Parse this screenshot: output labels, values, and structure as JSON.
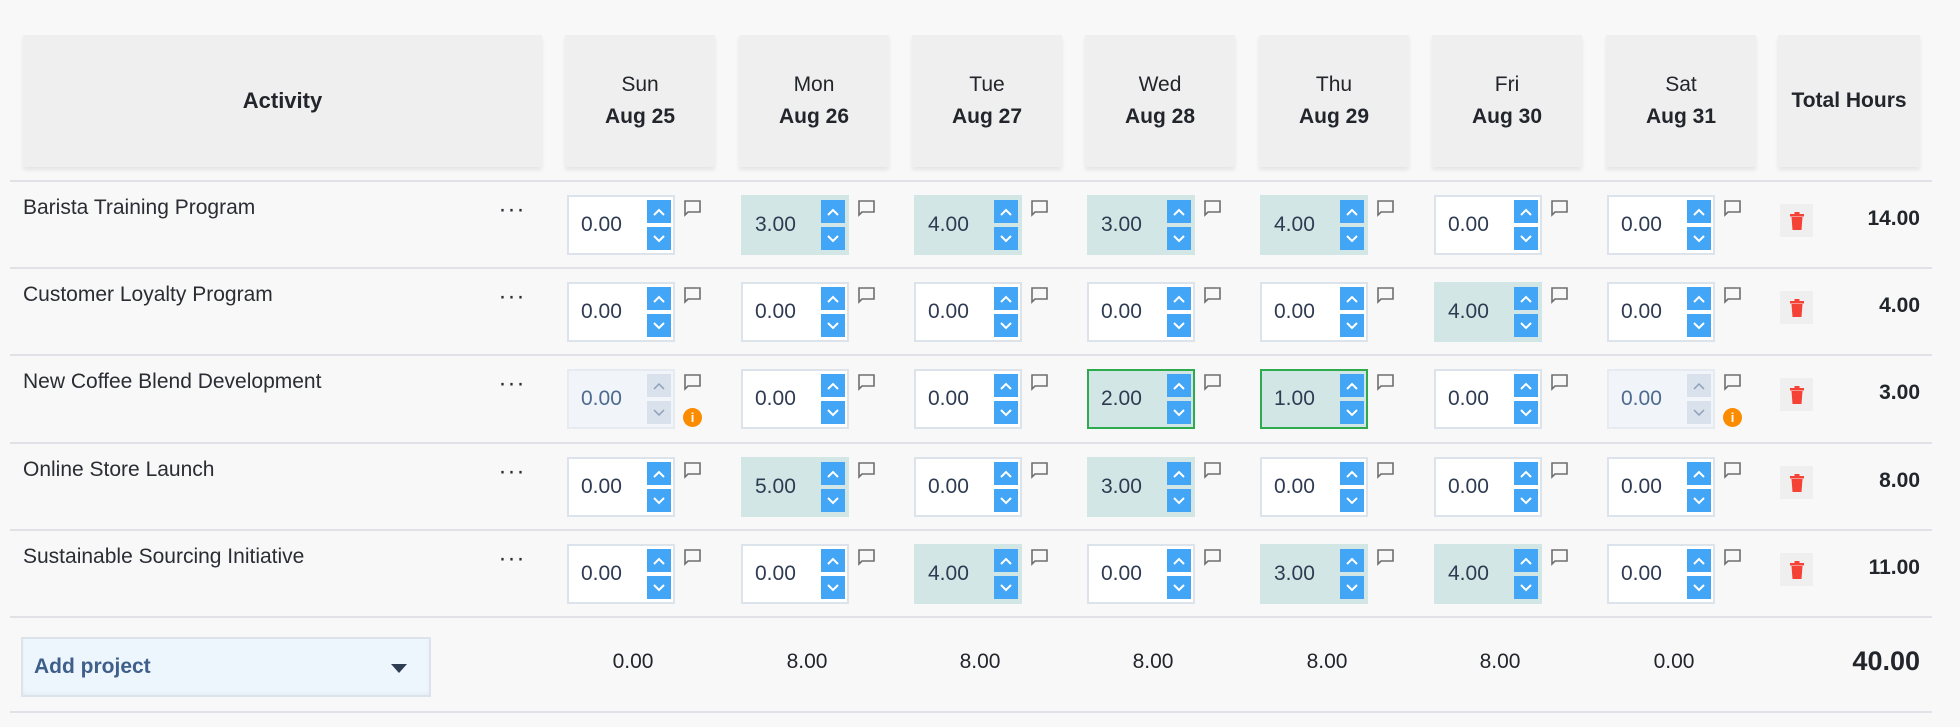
{
  "header": {
    "activity_label": "Activity",
    "total_label": "Total Hours",
    "days": [
      {
        "name": "Sun",
        "date": "Aug 25"
      },
      {
        "name": "Mon",
        "date": "Aug 26"
      },
      {
        "name": "Tue",
        "date": "Aug 27"
      },
      {
        "name": "Wed",
        "date": "Aug 28"
      },
      {
        "name": "Thu",
        "date": "Aug 29"
      },
      {
        "name": "Fri",
        "date": "Aug 30"
      },
      {
        "name": "Sat",
        "date": "Aug 31"
      }
    ]
  },
  "icons": {
    "row_menu": "ellipsis-icon",
    "spin_up": "chevron-up-icon",
    "spin_down": "chevron-down-icon",
    "comment": "comment-icon",
    "info": "info-icon",
    "delete": "trash-icon",
    "dropdown": "caret-down-icon"
  },
  "colors": {
    "spin_button": "#42a5f5",
    "filled_cell": "#d2e7e5",
    "active_border": "#2eaa4f",
    "warning": "#fb8c00",
    "delete": "#f44336"
  },
  "row_menu_label": "···",
  "info_glyph": "i",
  "rows": [
    {
      "name": "Barista Training Program",
      "total": "14.00",
      "cells": [
        {
          "value": "0.00",
          "state": "empty"
        },
        {
          "value": "3.00",
          "state": "filled"
        },
        {
          "value": "4.00",
          "state": "filled"
        },
        {
          "value": "3.00",
          "state": "filled"
        },
        {
          "value": "4.00",
          "state": "filled"
        },
        {
          "value": "0.00",
          "state": "empty"
        },
        {
          "value": "0.00",
          "state": "empty"
        }
      ]
    },
    {
      "name": "Customer Loyalty Program",
      "total": "4.00",
      "cells": [
        {
          "value": "0.00",
          "state": "empty"
        },
        {
          "value": "0.00",
          "state": "empty"
        },
        {
          "value": "0.00",
          "state": "empty"
        },
        {
          "value": "0.00",
          "state": "empty"
        },
        {
          "value": "0.00",
          "state": "empty"
        },
        {
          "value": "4.00",
          "state": "filled"
        },
        {
          "value": "0.00",
          "state": "empty"
        }
      ]
    },
    {
      "name": "New Coffee Blend Development",
      "total": "3.00",
      "cells": [
        {
          "value": "0.00",
          "state": "disabled",
          "info": true
        },
        {
          "value": "0.00",
          "state": "empty"
        },
        {
          "value": "0.00",
          "state": "empty"
        },
        {
          "value": "2.00",
          "state": "filled-active"
        },
        {
          "value": "1.00",
          "state": "filled-active"
        },
        {
          "value": "0.00",
          "state": "empty"
        },
        {
          "value": "0.00",
          "state": "disabled-active",
          "info": true
        }
      ]
    },
    {
      "name": "Online Store Launch",
      "total": "8.00",
      "cells": [
        {
          "value": "0.00",
          "state": "empty"
        },
        {
          "value": "5.00",
          "state": "filled"
        },
        {
          "value": "0.00",
          "state": "empty"
        },
        {
          "value": "3.00",
          "state": "filled"
        },
        {
          "value": "0.00",
          "state": "empty"
        },
        {
          "value": "0.00",
          "state": "empty"
        },
        {
          "value": "0.00",
          "state": "empty"
        }
      ]
    },
    {
      "name": "Sustainable Sourcing Initiative",
      "total": "11.00",
      "cells": [
        {
          "value": "0.00",
          "state": "empty"
        },
        {
          "value": "0.00",
          "state": "empty"
        },
        {
          "value": "4.00",
          "state": "filled"
        },
        {
          "value": "0.00",
          "state": "empty"
        },
        {
          "value": "3.00",
          "state": "filled"
        },
        {
          "value": "4.00",
          "state": "filled"
        },
        {
          "value": "0.00",
          "state": "empty"
        }
      ]
    }
  ],
  "footer": {
    "add_project_label": "Add project",
    "day_totals": [
      "0.00",
      "8.00",
      "8.00",
      "8.00",
      "8.00",
      "8.00",
      "0.00"
    ],
    "grand_total": "40.00"
  }
}
